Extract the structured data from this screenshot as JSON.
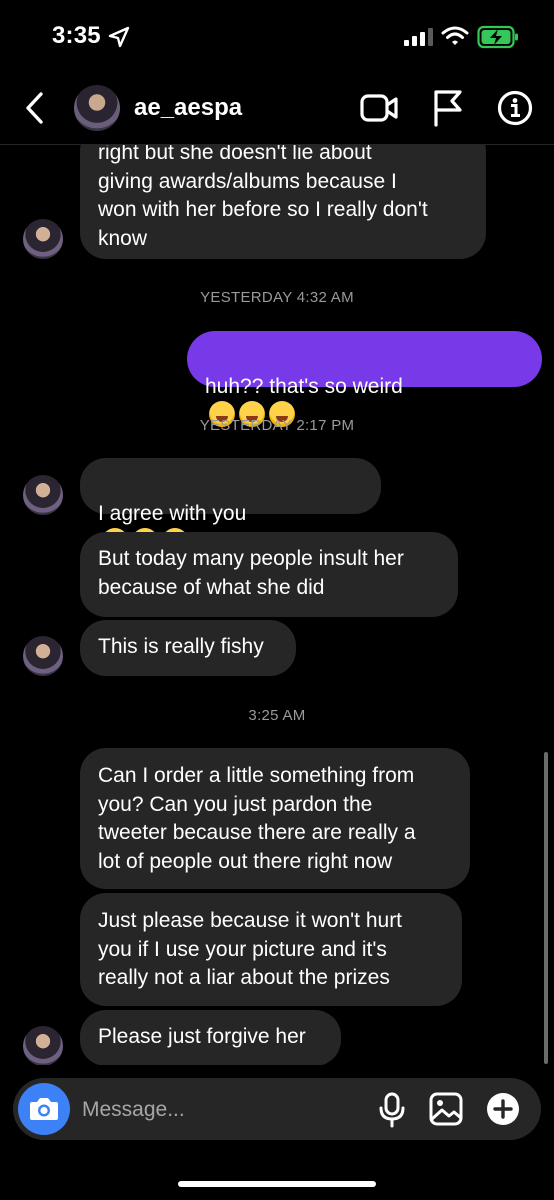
{
  "status_bar": {
    "time": "3:35"
  },
  "header": {
    "username": "ae_aespa"
  },
  "messages": [
    {
      "text": "right but she doesn't lie about\ngiving awards/albums because I\nwon with her before so I really don't\nknow"
    },
    {
      "timestamp": "YESTERDAY 4:32 AM"
    },
    {
      "text": "huh?? that's so weird"
    },
    {
      "timestamp": "YESTERDAY 2:17 PM"
    },
    {
      "text": "I agree with you"
    },
    {
      "text": "But today many people insult her\nbecause of what she did"
    },
    {
      "text": "This is really fishy"
    },
    {
      "timestamp": "3:25 AM"
    },
    {
      "text": "Can I order a little something from\nyou? Can you just pardon the\ntweeter because there are really a\nlot of people out there right now"
    },
    {
      "text": "Just please because it won't hurt\nyou if I use your picture and it's\nreally not a liar about the prizes"
    },
    {
      "text": "Please just forgive her"
    }
  ],
  "composer": {
    "placeholder": "Message..."
  },
  "icons": {
    "location": "location-arrow-icon",
    "signal": "cellular-signal-icon",
    "wifi": "wifi-icon",
    "battery": "battery-charging-icon",
    "back": "chevron-left-icon",
    "video": "video-camera-icon",
    "flag": "flag-icon",
    "info": "info-icon",
    "camera": "camera-icon",
    "mic": "microphone-icon",
    "gallery": "image-gallery-icon",
    "add": "plus-circle-icon",
    "emoji": "loudly-crying-face-emoji"
  },
  "colors": {
    "background": "#000000",
    "received_bubble": "#262626",
    "sent_bubble": "#7839e8",
    "camera_button": "#3c82f6",
    "battery_green": "#34c759",
    "timestamp_text": "#9a9a9a"
  }
}
